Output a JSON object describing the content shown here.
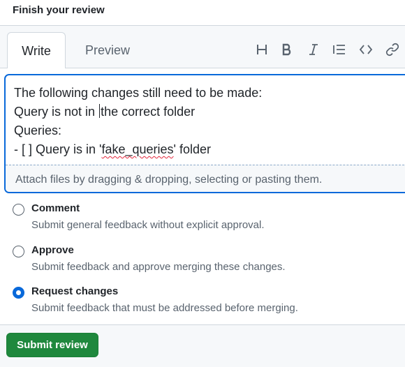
{
  "header": {
    "title": "Finish your review"
  },
  "tabs": [
    {
      "label": "Write",
      "active": true
    },
    {
      "label": "Preview",
      "active": false
    }
  ],
  "toolbar": {
    "icons": [
      "heading-icon",
      "bold-icon",
      "italic-icon",
      "quote-list-icon",
      "code-icon",
      "link-icon"
    ]
  },
  "editor": {
    "lines": [
      "The following changes still need to be made:",
      "Query is not in ",
      "the correct folder",
      "Queries:",
      "- [ ] Query is in '",
      "fake_queries",
      "' folder"
    ],
    "attach_text": "Attach files by dragging & dropping, selecting or pasting them."
  },
  "options": [
    {
      "label": "Comment",
      "description": "Submit general feedback without explicit approval.",
      "checked": false
    },
    {
      "label": "Approve",
      "description": "Submit feedback and approve merging these changes.",
      "checked": false
    },
    {
      "label": "Request changes",
      "description": "Submit feedback that must be addressed before merging.",
      "checked": true
    }
  ],
  "footer": {
    "submit_label": "Submit review"
  },
  "colors": {
    "accent": "#0969da",
    "submit_bg": "#1f883d",
    "muted": "#59636e"
  }
}
